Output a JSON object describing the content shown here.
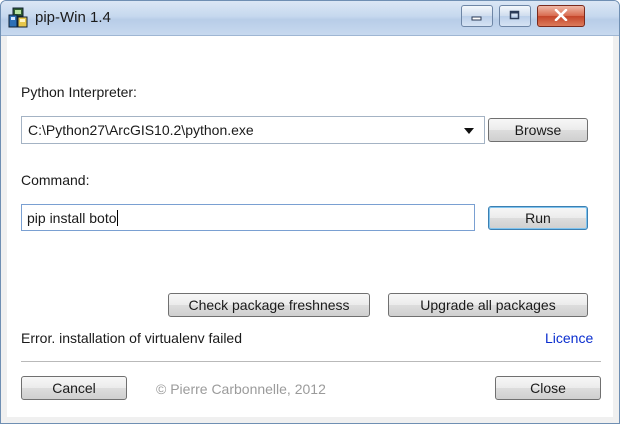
{
  "window": {
    "title": "pip-Win 1.4",
    "controls": {
      "minimize": "minimize",
      "maximize": "maximize",
      "close": "close"
    }
  },
  "interpreter": {
    "label": "Python Interpreter:",
    "value": "C:\\Python27\\ArcGIS10.2\\python.exe",
    "browse_label": "Browse"
  },
  "command": {
    "label": "Command:",
    "value": "pip install boto",
    "run_label": "Run"
  },
  "actions": {
    "check_freshness_label": "Check package freshness",
    "upgrade_all_label": "Upgrade all packages"
  },
  "status": {
    "message": "Error. installation of virtualenv failed",
    "licence_link": "Licence"
  },
  "footer": {
    "cancel_label": "Cancel",
    "copyright": "© Pierre Carbonnelle, 2012",
    "close_label": "Close"
  },
  "colors": {
    "link": "#0a2ecf",
    "titlebar": "#c6d8ee",
    "close_button": "#c4452a"
  },
  "icons": {
    "app": "pip-win-app-icon",
    "dropdown": "chevron-down-icon",
    "minimize": "minimize-icon",
    "maximize": "maximize-icon",
    "close": "close-icon"
  }
}
